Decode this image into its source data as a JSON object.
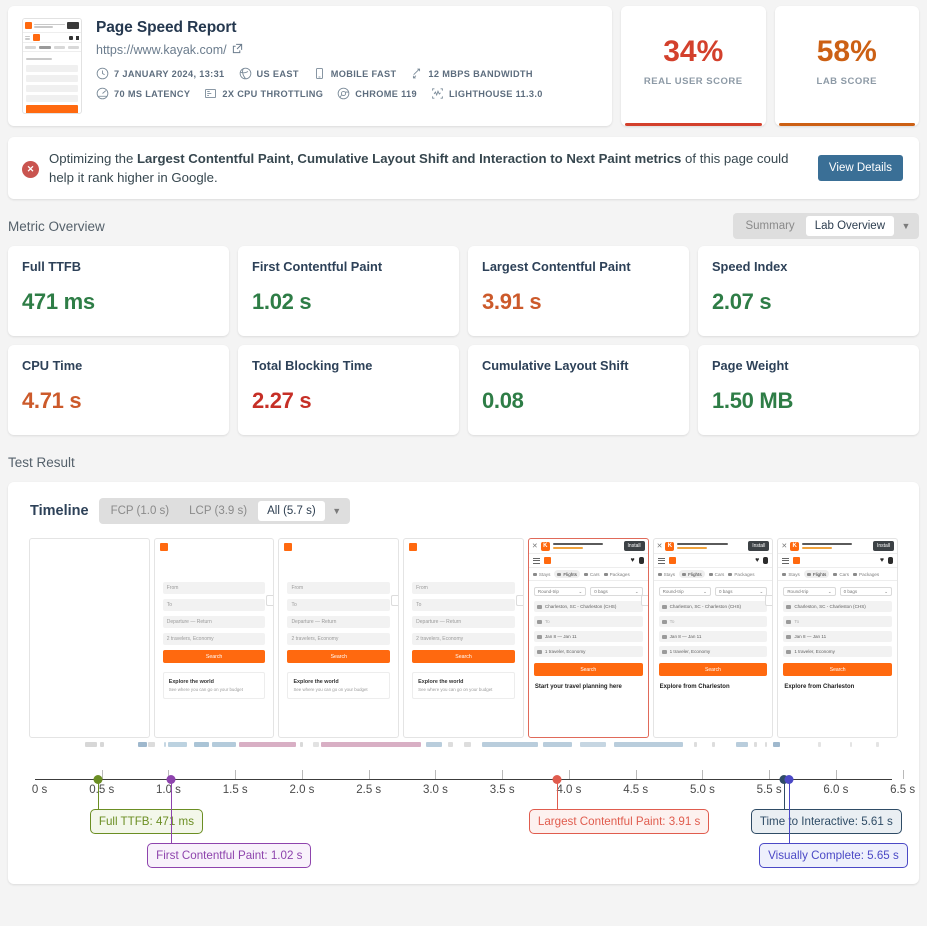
{
  "report": {
    "title": "Page Speed Report",
    "url": "https://www.kayak.com/",
    "external_link_icon": "external-link-icon",
    "meta": [
      {
        "icon": "clock-icon",
        "label": "7 JANUARY 2024, 13:31"
      },
      {
        "icon": "globe-icon",
        "label": "US EAST"
      },
      {
        "icon": "mobile-icon",
        "label": "MOBILE FAST"
      },
      {
        "icon": "bandwidth-icon",
        "label": "12 MBPS BANDWIDTH"
      },
      {
        "icon": "latency-icon",
        "label": "70 MS LATENCY"
      },
      {
        "icon": "cpu-icon",
        "label": "2X CPU THROTTLING"
      },
      {
        "icon": "chrome-icon",
        "label": "CHROME 119"
      },
      {
        "icon": "lighthouse-icon",
        "label": "LIGHTHOUSE 11.3.0"
      }
    ]
  },
  "scores": [
    {
      "value": "34%",
      "label": "REAL USER SCORE",
      "color": "#d3402c"
    },
    {
      "value": "58%",
      "label": "LAB SCORE",
      "color": "#cc6014"
    }
  ],
  "alert": {
    "icon": "error-circle-icon",
    "prefix": "Optimizing the ",
    "bold": "Largest Contentful Paint, Cumulative Layout Shift and Interaction to Next Paint metrics",
    "suffix": " of this page could help it rank higher in Google.",
    "button": "View Details",
    "button_color": "#3a6f96"
  },
  "metric_overview": {
    "title": "Metric Overview",
    "toggle": {
      "options": [
        "Summary",
        "Lab Overview"
      ],
      "selected": "Lab Overview",
      "caret_icon": "chevron-down-icon"
    },
    "cards": [
      {
        "label": "Full TTFB",
        "value": "471 ms",
        "color": "#2e7d46"
      },
      {
        "label": "First Contentful Paint",
        "value": "1.02 s",
        "color": "#2e7d46"
      },
      {
        "label": "Largest Contentful Paint",
        "value": "3.91 s",
        "color": "#cc5a2b"
      },
      {
        "label": "Speed Index",
        "value": "2.07 s",
        "color": "#2e7d46"
      },
      {
        "label": "CPU Time",
        "value": "4.71 s",
        "color": "#cc5a2b"
      },
      {
        "label": "Total Blocking Time",
        "value": "2.27 s",
        "color": "#c62f26"
      },
      {
        "label": "Cumulative Layout Shift",
        "value": "0.08",
        "color": "#2e7d46"
      },
      {
        "label": "Page Weight",
        "value": "1.50 MB",
        "color": "#2e7d46"
      }
    ]
  },
  "test_result": {
    "title": "Test Result",
    "timeline": {
      "title": "Timeline",
      "filters": [
        {
          "label": "FCP (1.0 s)",
          "active": false
        },
        {
          "label": "LCP (3.9 s)",
          "active": false
        },
        {
          "label": "All (5.7 s)",
          "active": true
        }
      ],
      "caret_icon": "chevron-down-icon"
    }
  },
  "chart_data": {
    "type": "timeline",
    "title": "Timeline",
    "xlabel": "",
    "xlim": [
      0,
      6.75
    ],
    "tick_labels": [
      "0 s",
      "0.5 s",
      "1.0 s",
      "1.5 s",
      "2.0 s",
      "2.5 s",
      "3.0 s",
      "3.5 s",
      "4.0 s",
      "4.5 s",
      "5.0 s",
      "5.5 s",
      "6.0 s",
      "6.5 s"
    ],
    "tick_values": [
      0,
      0.5,
      1.0,
      1.5,
      2.0,
      2.5,
      3.0,
      3.5,
      4.0,
      4.5,
      5.0,
      5.5,
      6.0,
      6.5
    ],
    "markers": [
      {
        "name": "Full TTFB",
        "value": 0.471,
        "label": "Full TTFB: 471 ms",
        "color": "#6b8e23",
        "bg": "#f3f7ea",
        "row": 0
      },
      {
        "name": "First Contentful Paint",
        "value": 1.02,
        "label": "First Contentful Paint: 1.02 s",
        "color": "#8e44ad",
        "bg": "#f8f2fb",
        "row": 1
      },
      {
        "name": "Largest Contentful Paint",
        "value": 3.91,
        "label": "Largest Contentful Paint: 3.91 s",
        "color": "#e05c4e",
        "bg": "#fdf1ef",
        "row": 0
      },
      {
        "name": "Time to Interactive",
        "value": 5.61,
        "label": "Time to Interactive: 5.61 s",
        "color": "#2f4c66",
        "bg": "#eaeff3",
        "row": 0
      },
      {
        "name": "Visually Complete",
        "value": 5.65,
        "label": "Visually Complete: 5.65 s",
        "color": "#4b49c6",
        "bg": "#eef0fc",
        "row": 1
      }
    ],
    "filmstrip_frames": 7,
    "highlighted_frame_index": 4,
    "waterfall_segments": [
      {
        "start": 0.95,
        "width": 0.22,
        "color": "#d7d7d7"
      },
      {
        "start": 1.22,
        "width": 0.08,
        "color": "#d7d7d7"
      },
      {
        "start": 1.95,
        "width": 0.16,
        "color": "#9fb8cd"
      },
      {
        "start": 2.13,
        "width": 0.13,
        "color": "#dcdcdc"
      },
      {
        "start": 2.43,
        "width": 0.04,
        "color": "#c6d7e3"
      },
      {
        "start": 2.52,
        "width": 0.36,
        "color": "#bcd2e0"
      },
      {
        "start": 3.0,
        "width": 0.28,
        "color": "#aac4d6"
      },
      {
        "start": 3.35,
        "width": 0.45,
        "color": "#b4cbdb"
      },
      {
        "start": 3.85,
        "width": 1.08,
        "color": "#d8afc4"
      },
      {
        "start": 5.0,
        "width": 0.07,
        "color": "#d9d9d9"
      },
      {
        "start": 5.25,
        "width": 0.12,
        "color": "#e2e2e2"
      },
      {
        "start": 5.4,
        "width": 1.9,
        "color": "#d8afc4"
      },
      {
        "start": 7.4,
        "width": 0.3,
        "color": "#b9cddc"
      },
      {
        "start": 7.8,
        "width": 0.1,
        "color": "#dddddd"
      },
      {
        "start": 8.1,
        "width": 0.14,
        "color": "#dddddd"
      },
      {
        "start": 8.45,
        "width": 1.05,
        "color": "#b9cddc"
      },
      {
        "start": 9.6,
        "width": 0.55,
        "color": "#b9cddc"
      },
      {
        "start": 10.3,
        "width": 0.5,
        "color": "#c6d6e2"
      },
      {
        "start": 10.95,
        "width": 1.3,
        "color": "#b9cddc"
      },
      {
        "start": 12.45,
        "width": 0.06,
        "color": "#dddddd"
      },
      {
        "start": 12.8,
        "width": 0.05,
        "color": "#dddddd"
      },
      {
        "start": 13.25,
        "width": 0.22,
        "color": "#b9cddc"
      },
      {
        "start": 13.6,
        "width": 0.05,
        "color": "#dddddd"
      },
      {
        "start": 13.8,
        "width": 0.04,
        "color": "#dddddd"
      },
      {
        "start": 13.95,
        "width": 0.14,
        "color": "#9fb8cd"
      },
      {
        "start": 14.8,
        "width": 0.06,
        "color": "#e4e4e4"
      },
      {
        "start": 15.4,
        "width": 0.05,
        "color": "#e4e4e4"
      },
      {
        "start": 15.9,
        "width": 0.05,
        "color": "#e4e4e4"
      }
    ]
  },
  "mini_page": {
    "install_bar": {
      "close": "×",
      "brand": "KAYAK Flights, Hotels, & Cars",
      "rating": "4.6",
      "button": "Install"
    },
    "tabs": [
      "Stays",
      "Flights",
      "Cars",
      "Packages"
    ],
    "selected_tab": "Flights",
    "selects": [
      "Round-trip",
      "0 bags"
    ],
    "fields": [
      {
        "value": "Charleston, SC - Charleston (CHS)"
      },
      {
        "value": "To"
      },
      {
        "value": "Jan 8 — Jan 11"
      },
      {
        "value": "1 traveler, Economy"
      }
    ],
    "search_button": "Search",
    "headline": "Start your travel planning here",
    "headline_alt": "Explore from Charleston",
    "early_fields": [
      "From",
      "To",
      "Departure — Return",
      "2 travelers, Economy"
    ],
    "early_button": "Search",
    "early_card_title": "Explore the world",
    "early_card_sub": "See where you can go on your budget"
  }
}
